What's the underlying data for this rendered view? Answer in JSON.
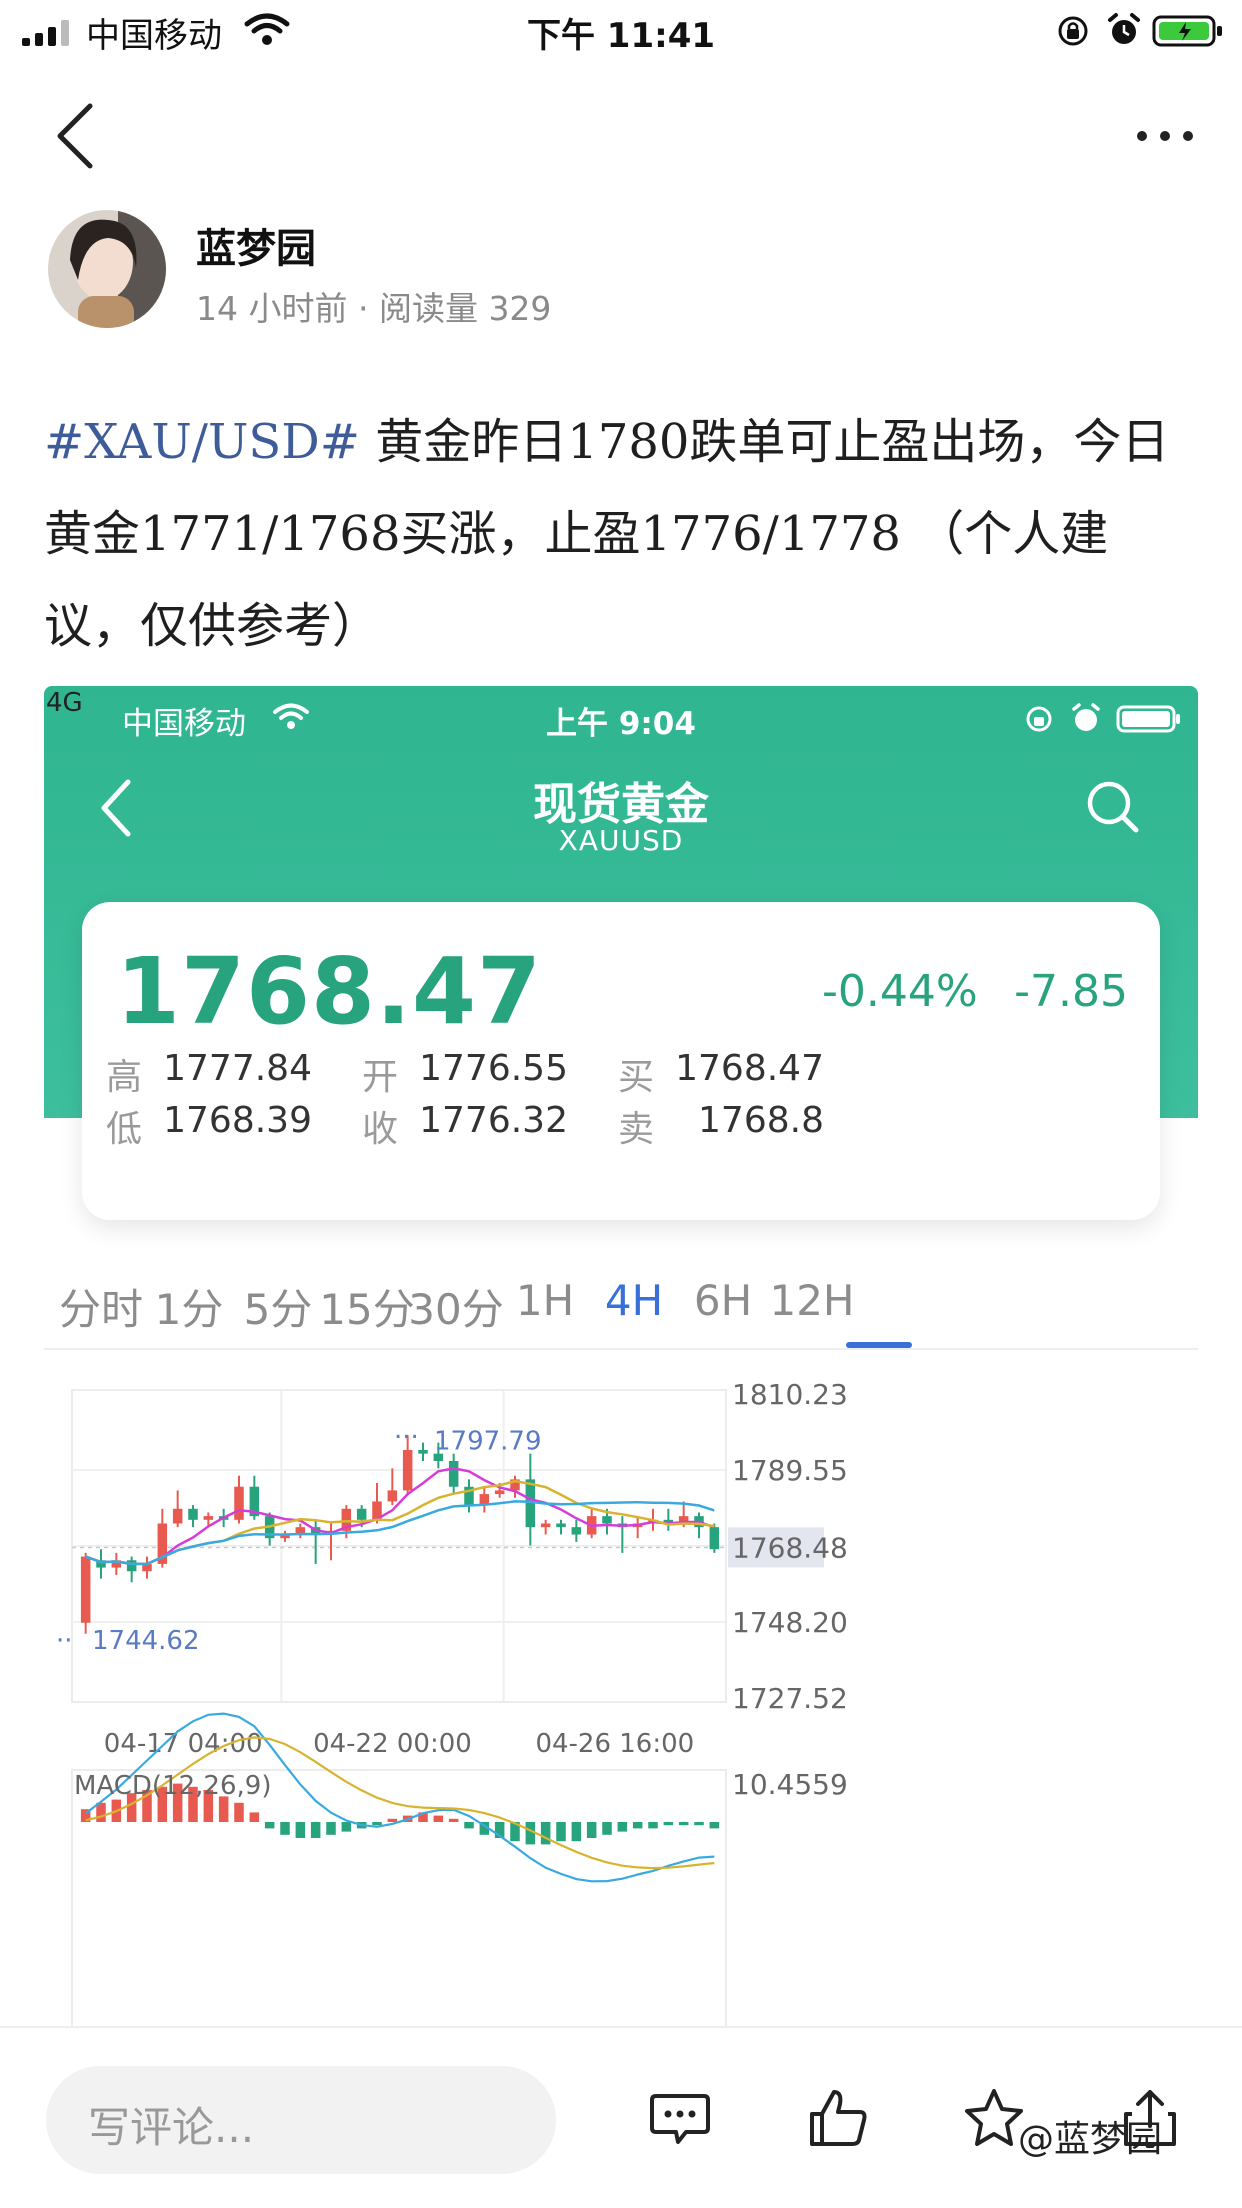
{
  "status_bar": {
    "carrier": "中国移动",
    "time": "下午 11:41"
  },
  "author": {
    "name": "蓝梦园",
    "meta": "14 小时前 · 阅读量 329"
  },
  "post": {
    "hashtag": "#XAU/USD#",
    "body": " 黄金昨日1780跌单可止盈出场，今日黄金1771/1768买涨，止盈1776/1778 （个人建议，仅供参考）"
  },
  "embedded": {
    "net": "4G",
    "carrier": "中国移动",
    "time": "上午 9:04",
    "title": "现货黄金",
    "subtitle": "XAUUSD",
    "quote": {
      "price": "1768.47",
      "change_pct": "-0.44%",
      "change": "-7.85",
      "rows": [
        {
          "l1": "高",
          "v1": "1777.84",
          "l2": "开",
          "v2": "1776.55",
          "l3": "买",
          "v3": "1768.47"
        },
        {
          "l1": "低",
          "v1": "1768.39",
          "l2": "收",
          "v2": "1776.32",
          "l3": "卖",
          "v3": "1768.8"
        }
      ]
    },
    "tabs": [
      "分时",
      "1分",
      "5分",
      "15分",
      "30分",
      "1H",
      "4H",
      "6H",
      "12H"
    ],
    "active_tab": "4H",
    "colors": {
      "teal": "#33b792",
      "up": "#e85a4f",
      "down": "#27a37d",
      "accent": "#3a6fd8"
    }
  },
  "chart_data": {
    "type": "candlestick",
    "y_ticks": [
      "1810.23",
      "1789.55",
      "1768.48",
      "1748.20",
      "1727.52"
    ],
    "ylim": [
      1727.52,
      1810.23
    ],
    "x_ticks": [
      "04-17 04:00",
      "04-22 00:00",
      "04-26 16:00"
    ],
    "current_price_label": "1768.48",
    "high_marker": "1797.79",
    "low_marker": "1744.62",
    "ohlc": [
      [
        1748,
        1766,
        1745,
        1767
      ],
      [
        1765,
        1763,
        1760,
        1768
      ],
      [
        1763,
        1765,
        1761,
        1767
      ],
      [
        1765,
        1762,
        1759,
        1766
      ],
      [
        1762,
        1764,
        1760,
        1766
      ],
      [
        1764,
        1775,
        1763,
        1779
      ],
      [
        1775,
        1779,
        1774,
        1784
      ],
      [
        1779,
        1776,
        1774,
        1780
      ],
      [
        1776,
        1777,
        1774,
        1778
      ],
      [
        1777,
        1776,
        1774,
        1779
      ],
      [
        1776,
        1785,
        1775,
        1788
      ],
      [
        1785,
        1777,
        1776,
        1788
      ],
      [
        1777,
        1771,
        1769,
        1778
      ],
      [
        1771,
        1772,
        1770,
        1773
      ],
      [
        1772,
        1774,
        1771,
        1775
      ],
      [
        1774,
        1772,
        1764,
        1776
      ],
      [
        1772,
        1773,
        1765,
        1775
      ],
      [
        1773,
        1779,
        1771,
        1780
      ],
      [
        1779,
        1776,
        1774,
        1780
      ],
      [
        1776,
        1781,
        1775,
        1786
      ],
      [
        1781,
        1784,
        1780,
        1790
      ],
      [
        1784,
        1795,
        1783,
        1799
      ],
      [
        1795,
        1794,
        1792,
        1797
      ],
      [
        1794,
        1792,
        1790,
        1797
      ],
      [
        1792,
        1785,
        1783,
        1794
      ],
      [
        1785,
        1780,
        1778,
        1787
      ],
      [
        1780,
        1783,
        1778,
        1785
      ],
      [
        1783,
        1784,
        1782,
        1786
      ],
      [
        1784,
        1787,
        1782,
        1788
      ],
      [
        1787,
        1774,
        1769,
        1794
      ],
      [
        1774,
        1775,
        1772,
        1776
      ],
      [
        1775,
        1774,
        1772,
        1776
      ],
      [
        1774,
        1772,
        1770,
        1776
      ],
      [
        1772,
        1777,
        1771,
        1779
      ],
      [
        1777,
        1775,
        1772,
        1779
      ],
      [
        1775,
        1774,
        1767,
        1777
      ],
      [
        1774,
        1775,
        1771,
        1777
      ],
      [
        1775,
        1776,
        1773,
        1779
      ],
      [
        1776,
        1775,
        1773,
        1779
      ],
      [
        1775,
        1777,
        1774,
        1781
      ],
      [
        1777,
        1774,
        1771,
        1778
      ],
      [
        1774,
        1768,
        1767,
        1775
      ]
    ],
    "macd_label": "MACD(12,26,9)",
    "macd_top_tick": "10.4559",
    "macd_hist": [
      4,
      6,
      7,
      9,
      10,
      11,
      12,
      11,
      10,
      8,
      6,
      3,
      -2,
      -4,
      -5,
      -5,
      -4,
      -3,
      -2,
      -1,
      1,
      2,
      3,
      2,
      1,
      -2,
      -4,
      -5,
      -6,
      -7,
      -7,
      -6,
      -6,
      -5,
      -4,
      -3,
      -2,
      -2,
      -1,
      -1,
      -1,
      -2
    ]
  },
  "bottom": {
    "comment_placeholder": "写评论...",
    "watermark": "@蓝梦园"
  }
}
